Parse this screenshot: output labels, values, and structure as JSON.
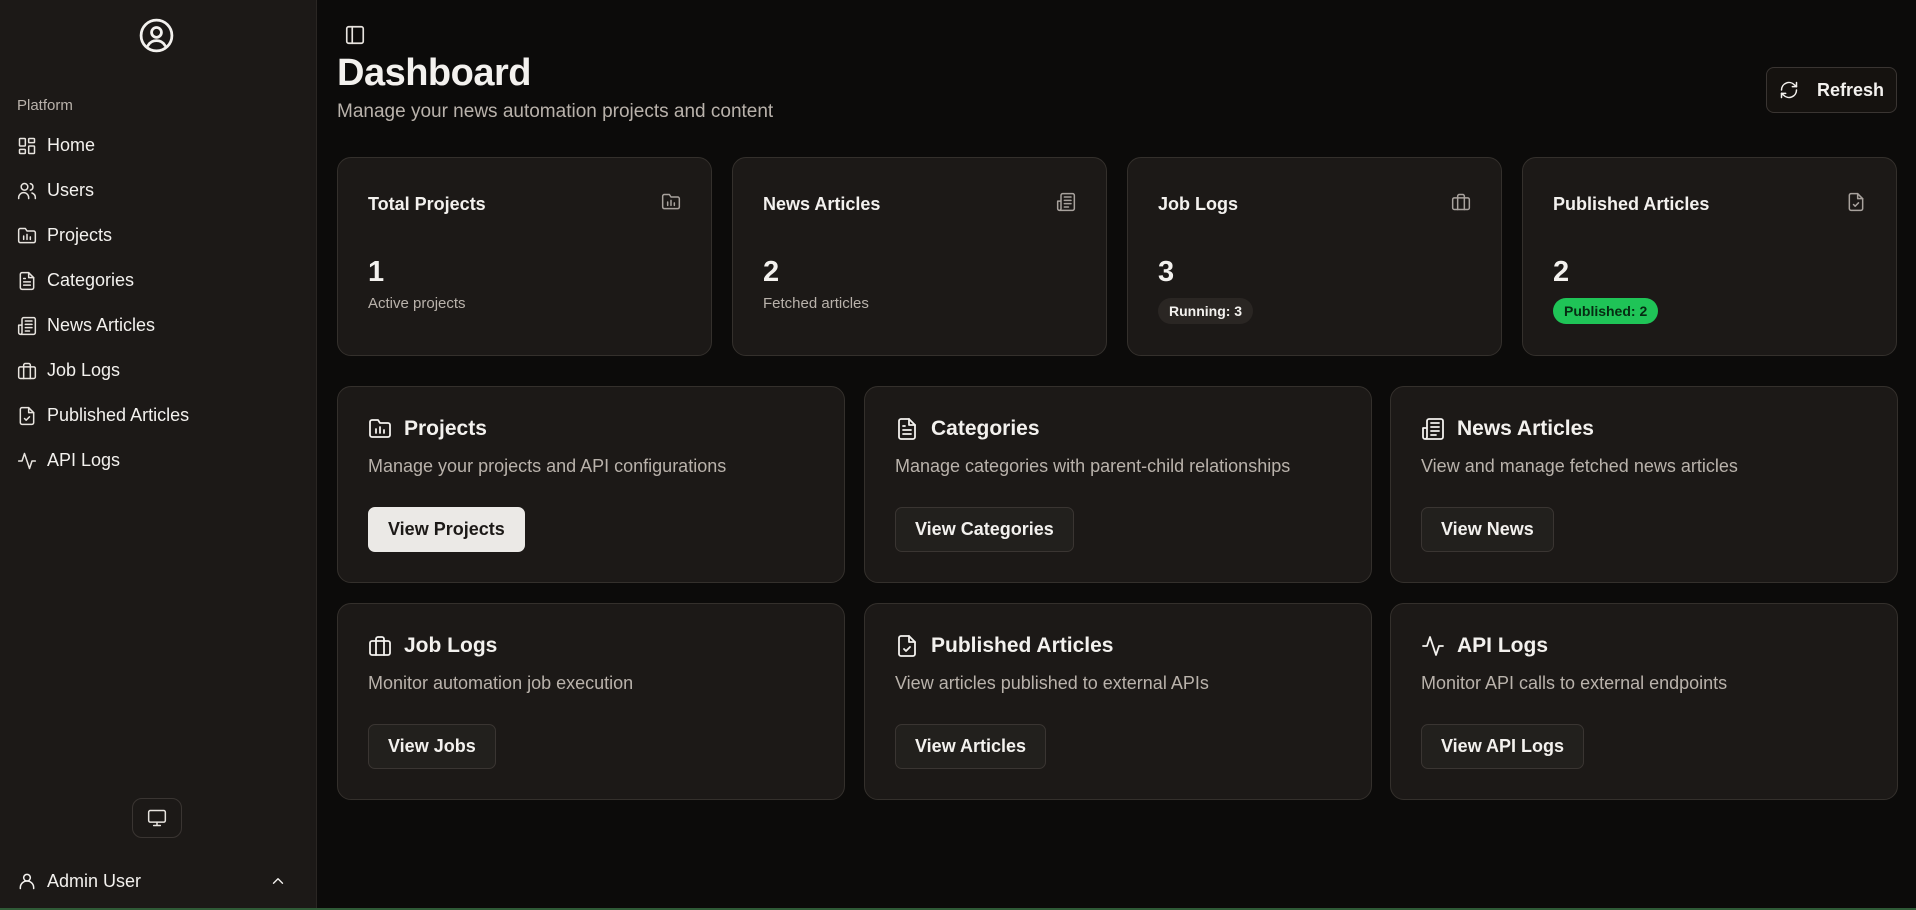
{
  "sidebar": {
    "section_label": "Platform",
    "items": [
      {
        "label": "Home",
        "icon": "dashboard-grid-icon"
      },
      {
        "label": "Users",
        "icon": "users-icon"
      },
      {
        "label": "Projects",
        "icon": "folder-chart-icon"
      },
      {
        "label": "Categories",
        "icon": "file-text-icon"
      },
      {
        "label": "News Articles",
        "icon": "newspaper-icon"
      },
      {
        "label": "Job Logs",
        "icon": "briefcase-icon"
      },
      {
        "label": "Published Articles",
        "icon": "file-check-icon"
      },
      {
        "label": "API Logs",
        "icon": "activity-icon"
      }
    ],
    "user": {
      "name": "Admin User"
    }
  },
  "header": {
    "title": "Dashboard",
    "subtitle": "Manage your news automation projects and content",
    "refresh_label": "Refresh"
  },
  "stats": [
    {
      "title": "Total Projects",
      "value": "1",
      "desc": "Active projects"
    },
    {
      "title": "News Articles",
      "value": "2",
      "desc": "Fetched articles"
    },
    {
      "title": "Job Logs",
      "value": "3",
      "badge": "Running: 3"
    },
    {
      "title": "Published Articles",
      "value": "2",
      "badge": "Published: 2"
    }
  ],
  "cards": [
    {
      "title": "Projects",
      "desc": "Manage your projects and API configurations",
      "button": "View Projects"
    },
    {
      "title": "Categories",
      "desc": "Manage categories with parent-child relationships",
      "button": "View Categories"
    },
    {
      "title": "News Articles",
      "desc": "View and manage fetched news articles",
      "button": "View News"
    },
    {
      "title": "Job Logs",
      "desc": "Monitor automation job execution",
      "button": "View Jobs"
    },
    {
      "title": "Published Articles",
      "desc": "View articles published to external APIs",
      "button": "View Articles"
    },
    {
      "title": "API Logs",
      "desc": "Monitor API calls to external endpoints",
      "button": "View API Logs"
    }
  ],
  "colors": {
    "background": "#0c0b0a",
    "sidebar": "#1c1917",
    "card": "#1c1917",
    "accent_green": "#1fc457"
  }
}
